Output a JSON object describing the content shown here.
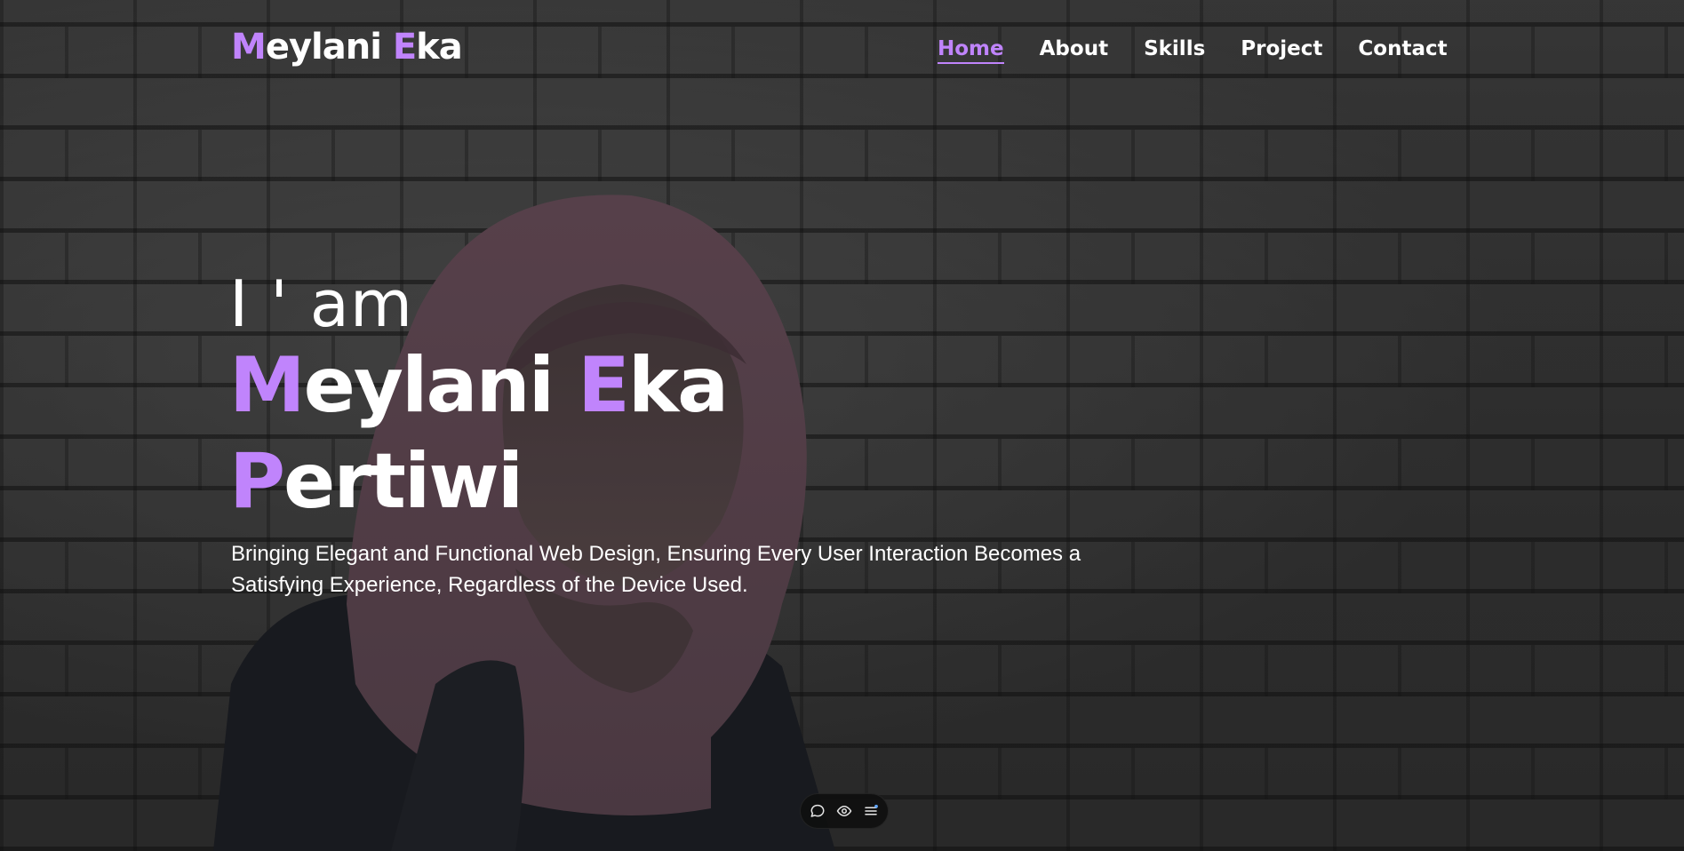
{
  "brand": {
    "first_initial": "M",
    "first_rest": "eylani ",
    "second_initial": "E",
    "second_rest": "ka"
  },
  "nav": {
    "items": [
      {
        "label": "Home",
        "active": true
      },
      {
        "label": "About",
        "active": false
      },
      {
        "label": "Skills",
        "active": false
      },
      {
        "label": "Project",
        "active": false
      },
      {
        "label": "Contact",
        "active": false
      }
    ]
  },
  "hero": {
    "intro": "I ' am",
    "name_line1": {
      "initial1": "M",
      "rest1": "eylani ",
      "initial2": "E",
      "rest2": "ka"
    },
    "name_line2": {
      "initial": "P",
      "rest": "ertiwi"
    },
    "description": "Bringing Elegant and Functional Web Design, Ensuring Every User Interaction Becomes a Satisfying Experience, Regardless of the Device Used."
  },
  "toolbar": {
    "icons": [
      "comment-icon",
      "eye-icon",
      "menu-icon"
    ]
  },
  "colors": {
    "accent": "#c084fc",
    "text": "#ffffff",
    "background": "#3f3f3f"
  }
}
